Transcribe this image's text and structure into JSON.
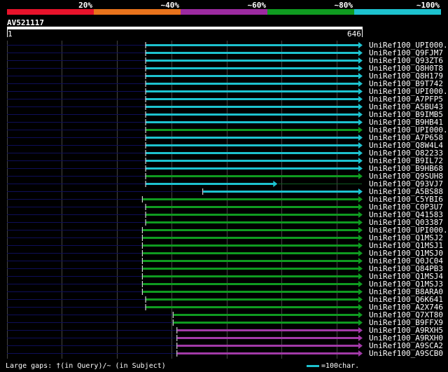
{
  "legend": {
    "items": [
      {
        "label": "20%",
        "color": "#e8132b"
      },
      {
        "label": "~40%",
        "color": "#e8731c"
      },
      {
        "label": "~60%",
        "color": "#9c2aa0"
      },
      {
        "label": "~80%",
        "color": "#0f9b20"
      },
      {
        "label": "~100%",
        "color": "#1dc2cf"
      }
    ]
  },
  "query": {
    "name": "AV521117",
    "start": "1",
    "end": "646",
    "length": 646
  },
  "grid_positions": [
    0,
    100,
    200,
    300,
    400,
    500,
    600
  ],
  "hits": [
    {
      "name": "UniRef100_UPI000...",
      "start": 253,
      "end": 646,
      "color": "cyan",
      "pre_line": true,
      "tail": false
    },
    {
      "name": "UniRef100_Q9FJM7",
      "start": 253,
      "end": 646,
      "color": "cyan",
      "pre_line": true,
      "tail": false
    },
    {
      "name": "UniRef100_Q93ZT6",
      "start": 253,
      "end": 646,
      "color": "cyan",
      "pre_line": true,
      "tail": false
    },
    {
      "name": "UniRef100_Q8H0T8",
      "start": 253,
      "end": 646,
      "color": "cyan",
      "pre_line": true,
      "tail": false
    },
    {
      "name": "UniRef100_Q8H179",
      "start": 253,
      "end": 646,
      "color": "cyan",
      "pre_line": true,
      "tail": false
    },
    {
      "name": "UniRef100_B9T742",
      "start": 253,
      "end": 646,
      "color": "cyan",
      "pre_line": true,
      "tail": false
    },
    {
      "name": "UniRef100_UPI000...",
      "start": 253,
      "end": 646,
      "color": "cyan",
      "pre_line": true,
      "tail": false
    },
    {
      "name": "UniRef100_A7PFP5",
      "start": 253,
      "end": 646,
      "color": "cyan",
      "pre_line": true,
      "tail": false
    },
    {
      "name": "UniRef100_A5BU43",
      "start": 253,
      "end": 646,
      "color": "cyan",
      "pre_line": true,
      "tail": false
    },
    {
      "name": "UniRef100_B9IMB5",
      "start": 253,
      "end": 646,
      "color": "cyan",
      "pre_line": true,
      "tail": false
    },
    {
      "name": "UniRef100_B9HB41",
      "start": 253,
      "end": 646,
      "color": "cyan",
      "pre_line": true,
      "tail": false
    },
    {
      "name": "UniRef100_UPI000...",
      "start": 253,
      "end": 646,
      "color": "green",
      "pre_line": true,
      "tail": false
    },
    {
      "name": "UniRef100_A7P658",
      "start": 253,
      "end": 646,
      "color": "cyan",
      "pre_line": true,
      "tail": false
    },
    {
      "name": "UniRef100_Q8W4L4",
      "start": 253,
      "end": 646,
      "color": "cyan",
      "pre_line": true,
      "tail": false
    },
    {
      "name": "UniRef100_O82233",
      "start": 253,
      "end": 646,
      "color": "cyan",
      "pre_line": true,
      "tail": false
    },
    {
      "name": "UniRef100_B9IL72",
      "start": 253,
      "end": 646,
      "color": "cyan",
      "pre_line": true,
      "tail": false
    },
    {
      "name": "UniRef100_B9HB68",
      "start": 253,
      "end": 646,
      "color": "cyan",
      "pre_line": true,
      "tail": false
    },
    {
      "name": "UniRef100_Q9SUH8",
      "start": 253,
      "end": 646,
      "color": "green",
      "pre_line": true,
      "tail": false
    },
    {
      "name": "UniRef100_Q93VJ7",
      "start": 253,
      "end": 491,
      "color": "cyan",
      "pre_line": true,
      "tail": true
    },
    {
      "name": "UniRef100_A5BS88",
      "start": 357,
      "end": 646,
      "color": "cyan",
      "pre_line": true,
      "tail": false
    },
    {
      "name": "UniRef100_C5YBI6",
      "start": 247,
      "end": 646,
      "color": "green",
      "pre_line": true,
      "tail": false
    },
    {
      "name": "UniRef100_C0P3U7",
      "start": 253,
      "end": 646,
      "color": "green",
      "pre_line": true,
      "tail": false
    },
    {
      "name": "UniRef100_Q41583",
      "start": 253,
      "end": 646,
      "color": "green",
      "pre_line": true,
      "tail": false
    },
    {
      "name": "UniRef100_Q03387",
      "start": 253,
      "end": 646,
      "color": "green",
      "pre_line": true,
      "tail": false
    },
    {
      "name": "UniRef100_UPI000...",
      "start": 247,
      "end": 646,
      "color": "green",
      "pre_line": true,
      "tail": false
    },
    {
      "name": "UniRef100_Q1MSJ2",
      "start": 247,
      "end": 646,
      "color": "green",
      "pre_line": true,
      "tail": false
    },
    {
      "name": "UniRef100_Q1MSJ1",
      "start": 247,
      "end": 646,
      "color": "green",
      "pre_line": true,
      "tail": false
    },
    {
      "name": "UniRef100_Q1MSJ0",
      "start": 247,
      "end": 646,
      "color": "green",
      "pre_line": true,
      "tail": false
    },
    {
      "name": "UniRef100_Q0JC04",
      "start": 247,
      "end": 646,
      "color": "green",
      "pre_line": true,
      "tail": false
    },
    {
      "name": "UniRef100_Q84PB3",
      "start": 247,
      "end": 646,
      "color": "green",
      "pre_line": true,
      "tail": false
    },
    {
      "name": "UniRef100_Q1MSJ4",
      "start": 247,
      "end": 646,
      "color": "green",
      "pre_line": true,
      "tail": false
    },
    {
      "name": "UniRef100_Q1MSJ3",
      "start": 247,
      "end": 646,
      "color": "green",
      "pre_line": true,
      "tail": false
    },
    {
      "name": "UniRef100_B8ARA0",
      "start": 247,
      "end": 646,
      "color": "green",
      "pre_line": true,
      "tail": false
    },
    {
      "name": "UniRef100_Q6K641",
      "start": 253,
      "end": 646,
      "color": "green",
      "pre_line": true,
      "tail": false
    },
    {
      "name": "UniRef100_A2X746",
      "start": 253,
      "end": 646,
      "color": "green",
      "pre_line": true,
      "tail": false
    },
    {
      "name": "UniRef100_Q7XT80",
      "start": 303,
      "end": 646,
      "color": "green",
      "pre_line": true,
      "tail": false
    },
    {
      "name": "UniRef100_B9FFX9",
      "start": 303,
      "end": 646,
      "color": "green",
      "pre_line": true,
      "tail": false
    },
    {
      "name": "UniRef100_A9RXH5",
      "start": 310,
      "end": 646,
      "color": "purple",
      "pre_line": true,
      "tail": false
    },
    {
      "name": "UniRef100_A9RXH0",
      "start": 310,
      "end": 646,
      "color": "purple",
      "pre_line": true,
      "tail": false
    },
    {
      "name": "UniRef100_A9SCA2",
      "start": 310,
      "end": 646,
      "color": "purple",
      "pre_line": true,
      "tail": false
    },
    {
      "name": "UniRef100_A9SCB0",
      "start": 310,
      "end": 646,
      "color": "purple",
      "pre_line": true,
      "tail": false
    }
  ],
  "colors": {
    "cyan": "#1dc2cf",
    "green": "#0f9b20",
    "purple": "#a23aa8",
    "pre": "#0e0e58",
    "grid": "#444444"
  },
  "footer": {
    "text": "Large gaps: †(in Query)/~ (in Subject)",
    "scale_text": "=100char."
  }
}
